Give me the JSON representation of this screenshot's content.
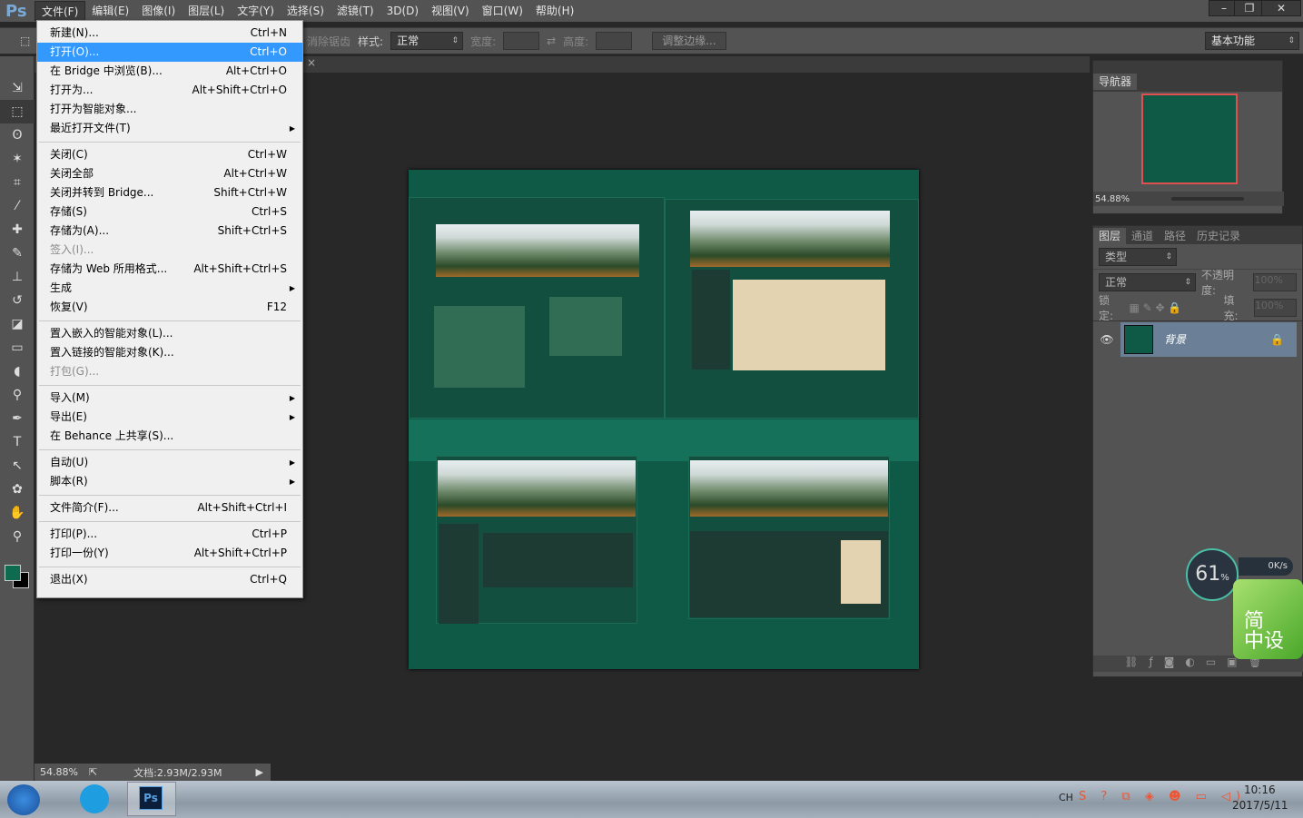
{
  "app": {
    "logo": "Ps"
  },
  "menubar": [
    "文件(F)",
    "编辑(E)",
    "图像(I)",
    "图层(L)",
    "文字(Y)",
    "选择(S)",
    "滤镜(T)",
    "3D(D)",
    "视图(V)",
    "窗口(W)",
    "帮助(H)"
  ],
  "window_controls": {
    "minimize": "–",
    "restore": "❐",
    "close": "✕"
  },
  "options": {
    "antialias": "消除锯齿",
    "style_label": "样式:",
    "style_value": "正常",
    "width_label": "宽度:",
    "height_label": "高度:",
    "refine_edge": "调整边缘...",
    "workspace": "基本功能"
  },
  "file_menu": [
    {
      "label": "新建(N)...",
      "shortcut": "Ctrl+N"
    },
    {
      "label": "打开(O)...",
      "shortcut": "Ctrl+O",
      "highlighted": true
    },
    {
      "label": "在 Bridge 中浏览(B)...",
      "shortcut": "Alt+Ctrl+O"
    },
    {
      "label": "打开为...",
      "shortcut": "Alt+Shift+Ctrl+O"
    },
    {
      "label": "打开为智能对象...",
      "shortcut": ""
    },
    {
      "label": "最近打开文件(T)",
      "shortcut": "",
      "submenu": true
    },
    {
      "separator": true
    },
    {
      "label": "关闭(C)",
      "shortcut": "Ctrl+W"
    },
    {
      "label": "关闭全部",
      "shortcut": "Alt+Ctrl+W"
    },
    {
      "label": "关闭并转到 Bridge...",
      "shortcut": "Shift+Ctrl+W"
    },
    {
      "label": "存储(S)",
      "shortcut": "Ctrl+S"
    },
    {
      "label": "存储为(A)...",
      "shortcut": "Shift+Ctrl+S"
    },
    {
      "label": "签入(I)...",
      "shortcut": "",
      "disabled": true
    },
    {
      "label": "存储为 Web 所用格式...",
      "shortcut": "Alt+Shift+Ctrl+S"
    },
    {
      "label": "生成",
      "shortcut": "",
      "submenu": true
    },
    {
      "label": "恢复(V)",
      "shortcut": "F12"
    },
    {
      "separator": true
    },
    {
      "label": "置入嵌入的智能对象(L)...",
      "shortcut": ""
    },
    {
      "label": "置入链接的智能对象(K)...",
      "shortcut": ""
    },
    {
      "label": "打包(G)...",
      "shortcut": "",
      "disabled": true
    },
    {
      "separator": true
    },
    {
      "label": "导入(M)",
      "shortcut": "",
      "submenu": true
    },
    {
      "label": "导出(E)",
      "shortcut": "",
      "submenu": true
    },
    {
      "label": "在 Behance 上共享(S)...",
      "shortcut": ""
    },
    {
      "separator": true
    },
    {
      "label": "自动(U)",
      "shortcut": "",
      "submenu": true
    },
    {
      "label": "脚本(R)",
      "shortcut": "",
      "submenu": true
    },
    {
      "separator": true
    },
    {
      "label": "文件简介(F)...",
      "shortcut": "Alt+Shift+Ctrl+I"
    },
    {
      "separator": true
    },
    {
      "label": "打印(P)...",
      "shortcut": "Ctrl+P"
    },
    {
      "label": "打印一份(Y)",
      "shortcut": "Alt+Shift+Ctrl+P"
    },
    {
      "separator": true
    },
    {
      "label": "退出(X)",
      "shortcut": "Ctrl+Q"
    }
  ],
  "tools": [
    "move",
    "marquee",
    "lasso",
    "magic-wand",
    "crop",
    "eyedropper",
    "healing",
    "brush",
    "stamp",
    "history-brush",
    "eraser",
    "gradient",
    "blur",
    "dodge",
    "pen",
    "type",
    "path-select",
    "shape",
    "hand",
    "zoom"
  ],
  "colors": {
    "foreground": "#0e6b4f",
    "background": "#000000",
    "highlight": "#3399ff",
    "doc_green": "#0e5a46"
  },
  "status": {
    "zoom": "54.88%",
    "doc": "文档:2.93M/2.93M"
  },
  "navigator": {
    "title": "导航器",
    "zoom": "54.88%"
  },
  "layers_panel": {
    "tabs": [
      "图层",
      "通道",
      "路径",
      "历史记录"
    ],
    "filter": "类型",
    "blend": "正常",
    "opacity_label": "不透明度:",
    "opacity": "100%",
    "lock_label": "锁定:",
    "fill_label": "填充:",
    "fill": "100%",
    "layer_name": "背景"
  },
  "widget": {
    "cpu": "61",
    "cpu_unit": "%",
    "speed": "0K/s",
    "badge_line1": "简",
    "badge_line2": "中设"
  },
  "taskbar": {
    "lang": "CH",
    "time": "10:16",
    "date": "2017/5/11"
  }
}
